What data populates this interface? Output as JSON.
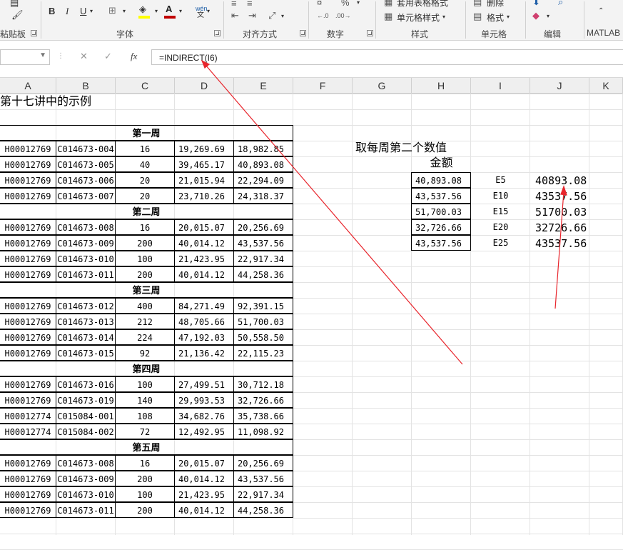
{
  "ribbon": {
    "groups": [
      {
        "label": "粘贴板"
      },
      {
        "label": "字体"
      },
      {
        "label": "对齐方式"
      },
      {
        "label": "数字"
      },
      {
        "label": "样式"
      },
      {
        "label": "单元格"
      },
      {
        "label": "编辑"
      },
      {
        "label": "MATLAB"
      }
    ],
    "style_items": [
      "套用表格格式",
      "单元格样式"
    ],
    "cell_items": [
      "删除",
      "格式"
    ],
    "font_bold": "B",
    "font_italic": "I",
    "font_underline": "U",
    "phonetic": "wén"
  },
  "formula_bar": {
    "fx": "fx",
    "formula": "=INDIRECT(I6)"
  },
  "columns": [
    "A",
    "B",
    "C",
    "D",
    "E",
    "F",
    "G",
    "H",
    "I",
    "J",
    "K"
  ],
  "sheet": {
    "title": "第十七讲中的示例",
    "weeks": [
      {
        "label": "第一周",
        "rows": [
          [
            "H00012769",
            "C014673-004",
            "16",
            "19,269.69",
            "18,982.85"
          ],
          [
            "H00012769",
            "C014673-005",
            "40",
            "39,465.17",
            "40,893.08"
          ],
          [
            "H00012769",
            "C014673-006",
            "20",
            "21,015.94",
            "22,294.09"
          ],
          [
            "H00012769",
            "C014673-007",
            "20",
            "23,710.26",
            "24,318.37"
          ]
        ]
      },
      {
        "label": "第二周",
        "rows": [
          [
            "H00012769",
            "C014673-008",
            "16",
            "20,015.07",
            "20,256.69"
          ],
          [
            "H00012769",
            "C014673-009",
            "200",
            "40,014.12",
            "43,537.56"
          ],
          [
            "H00012769",
            "C014673-010",
            "100",
            "21,423.95",
            "22,917.34"
          ],
          [
            "H00012769",
            "C014673-011",
            "200",
            "40,014.12",
            "44,258.36"
          ]
        ]
      },
      {
        "label": "第三周",
        "rows": [
          [
            "H00012769",
            "C014673-012",
            "400",
            "84,271.49",
            "92,391.15"
          ],
          [
            "H00012769",
            "C014673-013",
            "212",
            "48,705.66",
            "51,700.03"
          ],
          [
            "H00012769",
            "C014673-014",
            "224",
            "47,192.03",
            "50,558.50"
          ],
          [
            "H00012769",
            "C014673-015",
            "92",
            "21,136.42",
            "22,115.23"
          ]
        ]
      },
      {
        "label": "第四周",
        "rows": [
          [
            "H00012769",
            "C014673-016",
            "100",
            "27,499.51",
            "30,712.18"
          ],
          [
            "H00012769",
            "C014673-019",
            "140",
            "29,993.53",
            "32,726.66"
          ],
          [
            "H00012774",
            "C015084-001",
            "108",
            "34,682.76",
            "35,738.66"
          ],
          [
            "H00012774",
            "C015084-002",
            "72",
            "12,492.95",
            "11,098.92"
          ]
        ]
      },
      {
        "label": "第五周",
        "rows": [
          [
            "H00012769",
            "C014673-008",
            "16",
            "20,015.07",
            "20,256.69"
          ],
          [
            "H00012769",
            "C014673-009",
            "200",
            "40,014.12",
            "43,537.56"
          ],
          [
            "H00012769",
            "C014673-010",
            "100",
            "21,423.95",
            "22,917.34"
          ],
          [
            "H00012769",
            "C014673-011",
            "200",
            "40,014.12",
            "44,258.36"
          ]
        ]
      }
    ],
    "side_title": "取每周第二个数值",
    "side_header": "金额",
    "side_rows": [
      {
        "amount": "40,893.08",
        "ref": "E5",
        "value": "40893.08"
      },
      {
        "amount": "43,537.56",
        "ref": "E10",
        "value": "43537.56"
      },
      {
        "amount": "51,700.03",
        "ref": "E15",
        "value": "51700.03"
      },
      {
        "amount": "32,726.66",
        "ref": "E20",
        "value": "32726.66"
      },
      {
        "amount": "43,537.56",
        "ref": "E25",
        "value": "43537.56"
      }
    ]
  },
  "colors": {
    "annotation": "#e8252c",
    "accent_font": "#c00000",
    "fill_yellow": "#ffff00"
  }
}
